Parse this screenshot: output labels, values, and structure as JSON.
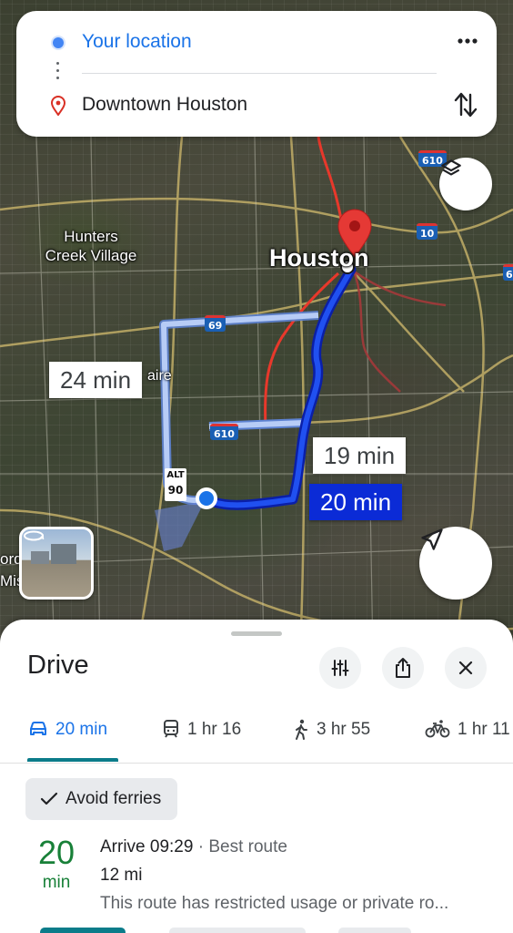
{
  "search": {
    "from": "Your location",
    "to": "Downtown Houston"
  },
  "map": {
    "labels": {
      "hunters_creek_line1": "Hunters",
      "hunters_creek_line2": "Creek Village",
      "city": "Houston",
      "bellaire_fragment": "aire",
      "left_clip_line1": "ord",
      "left_clip_line2": "Mis"
    },
    "shields": {
      "i610_top": "610",
      "i10": "10",
      "i69": "69",
      "i610_mid": "610",
      "us90_alt": "ALT",
      "us90": "90",
      "edge": "6"
    },
    "route_times": {
      "alt1": "24 min",
      "alt2": "19 min",
      "selected": "20 min"
    }
  },
  "sheet": {
    "title": "Drive",
    "modes": [
      {
        "icon": "car-icon",
        "label": "20 min"
      },
      {
        "icon": "transit-icon",
        "label": "1 hr 16"
      },
      {
        "icon": "walk-icon",
        "label": "3 hr 55"
      },
      {
        "icon": "bike-icon",
        "label": "1 hr 11"
      }
    ],
    "chip": "Avoid ferries",
    "route": {
      "time_num": "20",
      "time_unit": "min",
      "arrive": "Arrive 09:29",
      "best": " · Best route",
      "distance": "12 mi",
      "note": "This route has restricted usage or private ro..."
    }
  },
  "colors": {
    "selected_route": "#0b2bd6",
    "alt_route": "#a9c2f5",
    "traffic_red": "#e8382b",
    "accent": "#1a73e8",
    "green_time": "#188038"
  }
}
